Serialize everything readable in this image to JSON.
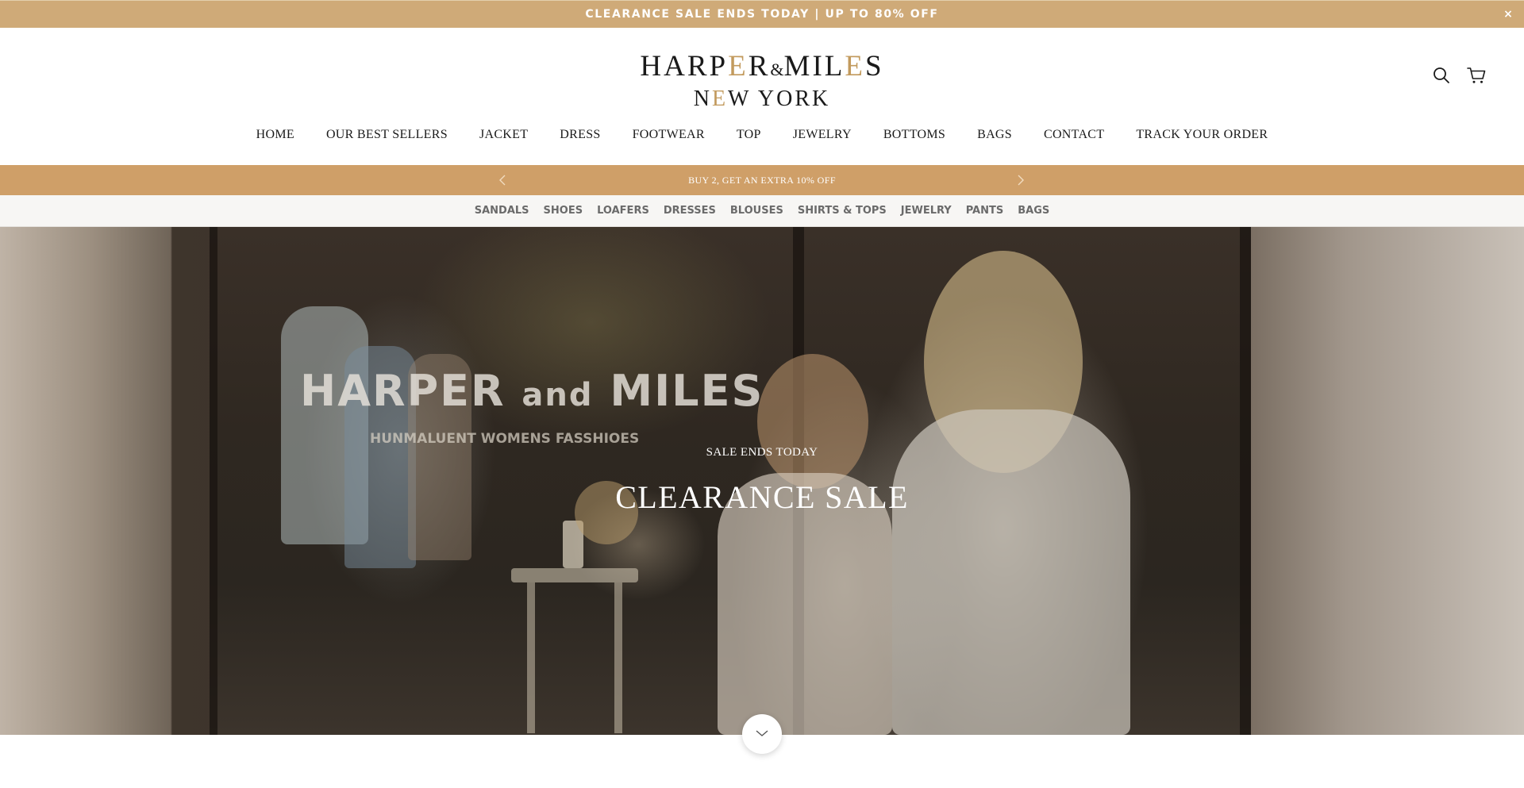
{
  "announcement": {
    "text": "CLEARANCE SALE ENDS TODAY | UP TO 80% OFF",
    "close_label": "×"
  },
  "logo": {
    "line1_a": "HARP",
    "line1_b": "E",
    "line1_c": "R",
    "line1_amp": "&",
    "line1_d": "MIL",
    "line1_e": "E",
    "line1_f": "S",
    "line2_a": "N",
    "line2_b": "E",
    "line2_c": "W YORK"
  },
  "header_icons": [
    "search-icon",
    "cart-icon"
  ],
  "main_nav": [
    {
      "label": "HOME"
    },
    {
      "label": "OUR BEST SELLERS"
    },
    {
      "label": "JACKET"
    },
    {
      "label": "DRESS"
    },
    {
      "label": "FOOTWEAR"
    },
    {
      "label": "TOP"
    },
    {
      "label": "JEWELRY"
    },
    {
      "label": "BOTTOMS"
    },
    {
      "label": "BAGS"
    },
    {
      "label": "CONTACT"
    },
    {
      "label": "TRACK YOUR ORDER"
    }
  ],
  "promo": {
    "text": "BUY 2, GET AN EXTRA 10% OFF"
  },
  "categories": [
    {
      "label": "SANDALS"
    },
    {
      "label": "SHOES"
    },
    {
      "label": "LOAFERS"
    },
    {
      "label": "DRESSES"
    },
    {
      "label": "BLOUSES"
    },
    {
      "label": "SHIRTS & TOPS"
    },
    {
      "label": "JEWELRY"
    },
    {
      "label": "PANTS"
    },
    {
      "label": "BAGS"
    }
  ],
  "hero": {
    "store_sign_a": "HARPER ",
    "store_sign_b": "and",
    "store_sign_c": " MILES",
    "store_sub": "HUNMALUENT WOMENS FASSHIOES",
    "eyebrow": "SALE ENDS TODAY",
    "title": "CLEARANCE SALE"
  },
  "colors": {
    "announcement_bg": "#cfaa78",
    "promo_bg": "#cf9f68",
    "logo_accent": "#c29a5d",
    "category_bar_bg": "#f7f6f4"
  }
}
